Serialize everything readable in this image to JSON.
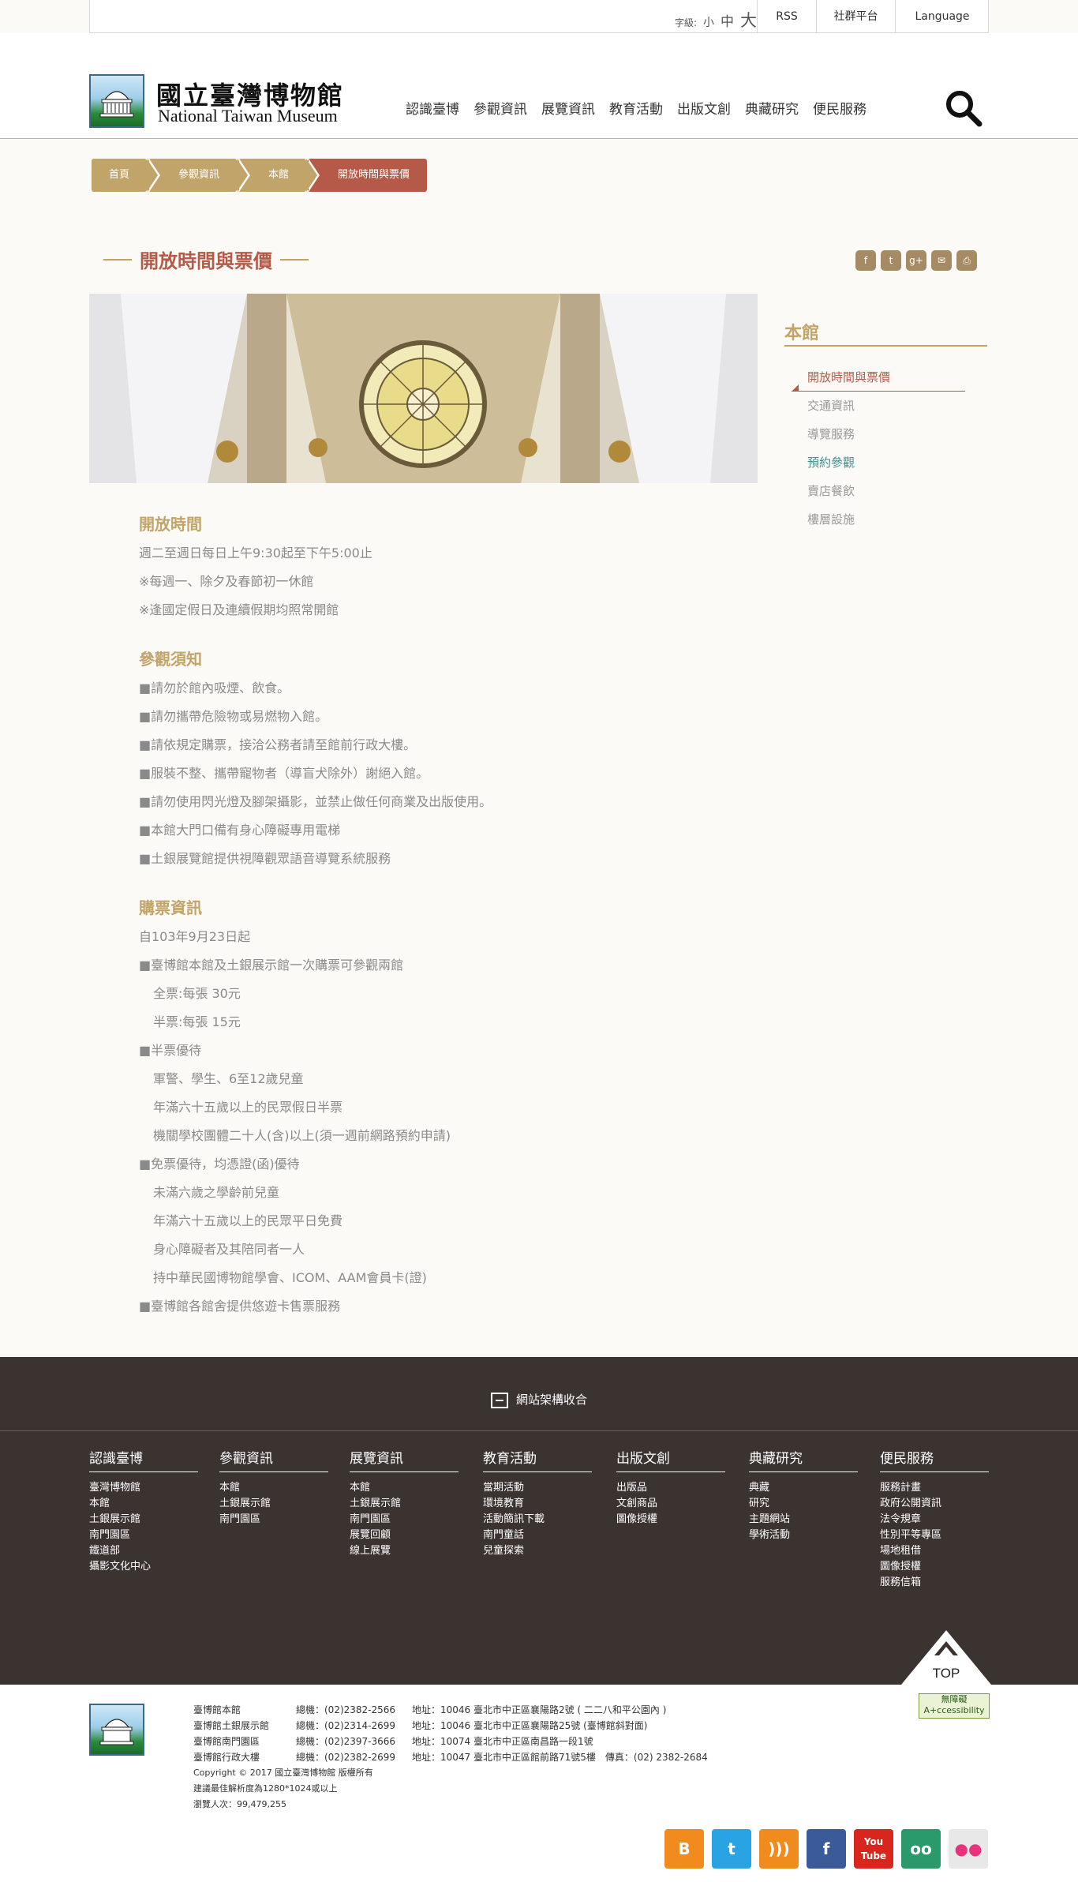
{
  "utilbar": {
    "font_size_label": "字級:",
    "font_small": "小",
    "font_medium": "中",
    "font_large": "大",
    "rss": "RSS",
    "social": "社群平台",
    "language": "Language"
  },
  "header": {
    "logo_cn": "國立臺灣博物館",
    "logo_en": "National Taiwan Museum",
    "nav": [
      "認識臺博",
      "參觀資訊",
      "展覽資訊",
      "教育活動",
      "出版文創",
      "典藏研究",
      "便民服務"
    ]
  },
  "breadcrumb": [
    "首頁",
    "參觀資訊",
    "本館",
    "開放時間與票價"
  ],
  "page_title": "開放時間與票價",
  "share_icons": [
    "facebook-icon",
    "twitter-icon",
    "googleplus-icon",
    "email-icon",
    "print-icon"
  ],
  "share_glyphs": [
    "f",
    "t",
    "g+",
    "✉",
    "⎙"
  ],
  "side": {
    "title": "本館",
    "items": [
      "開放時間與票價",
      "交通資訊",
      "導覽服務",
      "預約參觀",
      "賣店餐飲",
      "樓層設施"
    ]
  },
  "content": {
    "hours_title": "開放時間",
    "hours": [
      "週二至週日每日上午9:30起至下午5:00止",
      "※每週一、除夕及春節初一休館",
      "※逢國定假日及連續假期均照常開館"
    ],
    "notice_title": "參觀須知",
    "notices": [
      "■請勿於館內吸煙、飲食。",
      "■請勿攜帶危險物或易燃物入館。",
      "■請依規定購票，接洽公務者請至館前行政大樓。",
      "■服裝不整、攜帶寵物者（導盲犬除外）謝絕入館。",
      "■請勿使用閃光燈及腳架攝影，並禁止做任何商業及出版使用。",
      "■本館大門口備有身心障礙專用電梯",
      "■土銀展覽館提供視障觀眾語音導覽系統服務"
    ],
    "ticket_title": "購票資訊",
    "tickets": [
      {
        "text": "自103年9月23日起",
        "indent": false
      },
      {
        "text": "■臺博館本館及土銀展示館一次購票可參觀兩館",
        "indent": false
      },
      {
        "text": "全票:每張 30元",
        "indent": true
      },
      {
        "text": "半票:每張 15元",
        "indent": true
      },
      {
        "text": "■半票優待",
        "indent": false
      },
      {
        "text": "軍警、學生、6至12歲兒童",
        "indent": true
      },
      {
        "text": "年滿六十五歲以上的民眾假日半票",
        "indent": true
      },
      {
        "text": "機關學校團體二十人(含)以上(須一週前網路預約申請)",
        "indent": true
      },
      {
        "text": "■免票優待，均憑證(函)優待",
        "indent": false
      },
      {
        "text": "未滿六歲之學齡前兒童",
        "indent": true
      },
      {
        "text": "年滿六十五歲以上的民眾平日免費",
        "indent": true
      },
      {
        "text": "身心障礙者及其陪同者一人",
        "indent": true
      },
      {
        "text": "持中華民國博物館學會、ICOM、AAM會員卡(證)",
        "indent": true
      },
      {
        "text": "■臺博館各館舍提供悠遊卡售票服務",
        "indent": false
      }
    ]
  },
  "footer": {
    "collapse_label": "網站架構收合",
    "columns": [
      {
        "title": "認識臺博",
        "items": [
          "臺灣博物館",
          "本館",
          "土銀展示館",
          "南門園區",
          "鐵道部",
          "攝影文化中心"
        ]
      },
      {
        "title": "參觀資訊",
        "items": [
          "本館",
          "土銀展示館",
          "南門園區"
        ]
      },
      {
        "title": "展覽資訊",
        "items": [
          "本館",
          "土銀展示館",
          "南門園區",
          "展覽回顧",
          "線上展覽"
        ]
      },
      {
        "title": "教育活動",
        "items": [
          "當期活動",
          "環境教育",
          "活動簡訊下載",
          "南門童話",
          "兒童探索"
        ]
      },
      {
        "title": "出版文創",
        "items": [
          "出版品",
          "文創商品",
          "圖像授權"
        ]
      },
      {
        "title": "典藏研究",
        "items": [
          "典藏",
          "研究",
          "主題網站",
          "學術活動"
        ]
      },
      {
        "title": "便民服務",
        "items": [
          "服務計畫",
          "政府公開資訊",
          "法令規章",
          "性別平等專區",
          "場地租借",
          "圖像授權",
          "服務信箱"
        ]
      }
    ],
    "top_label": "TOP"
  },
  "bottom": {
    "rows": [
      {
        "name": "臺博館本館",
        "tel": "總機：(02)2382-2566",
        "addr": "地址：10046 臺北市中正區襄陽路2號 ( 二二八和平公園內 )"
      },
      {
        "name": "臺博館土銀展示館",
        "tel": "總機：(02)2314-2699",
        "addr": "地址：10046 臺北市中正區襄陽路25號 (臺博館斜對面)"
      },
      {
        "name": "臺博館南門園區",
        "tel": "總機：(02)2397-3666",
        "addr": "地址：10074 臺北市中正區南昌路一段1號"
      },
      {
        "name": "臺博館行政大樓",
        "tel": "總機：(02)2382-2699",
        "addr": "地址：10047 臺北市中正區館前路71號5樓　傳真：(02) 2382-2684"
      }
    ],
    "copyright": "Copyright © 2017  國立臺灣博物館 版權所有",
    "resolution": "建議最佳解析度為1280*1024或以上",
    "visitors": "瀏覽人次：99,479,255",
    "access_badge_1": "無障礙",
    "access_badge_2": "A+ccessibility",
    "social": [
      {
        "icon": "blogger-icon",
        "glyph": "B",
        "color": "#f28b1e"
      },
      {
        "icon": "twitter-icon",
        "glyph": "t",
        "color": "#2aa3e4"
      },
      {
        "icon": "rss-icon",
        "glyph": ")))",
        "color": "#f28b1e"
      },
      {
        "icon": "facebook-icon",
        "glyph": "f",
        "color": "#3b5a9a"
      },
      {
        "icon": "youtube-icon",
        "glyph": "You Tube",
        "color": "#d8261e"
      },
      {
        "icon": "tripadvisor-icon",
        "glyph": "oo",
        "color": "#2a9a6a"
      },
      {
        "icon": "flickr-icon",
        "glyph": "●●",
        "color": "#e8e8e8"
      }
    ]
  }
}
